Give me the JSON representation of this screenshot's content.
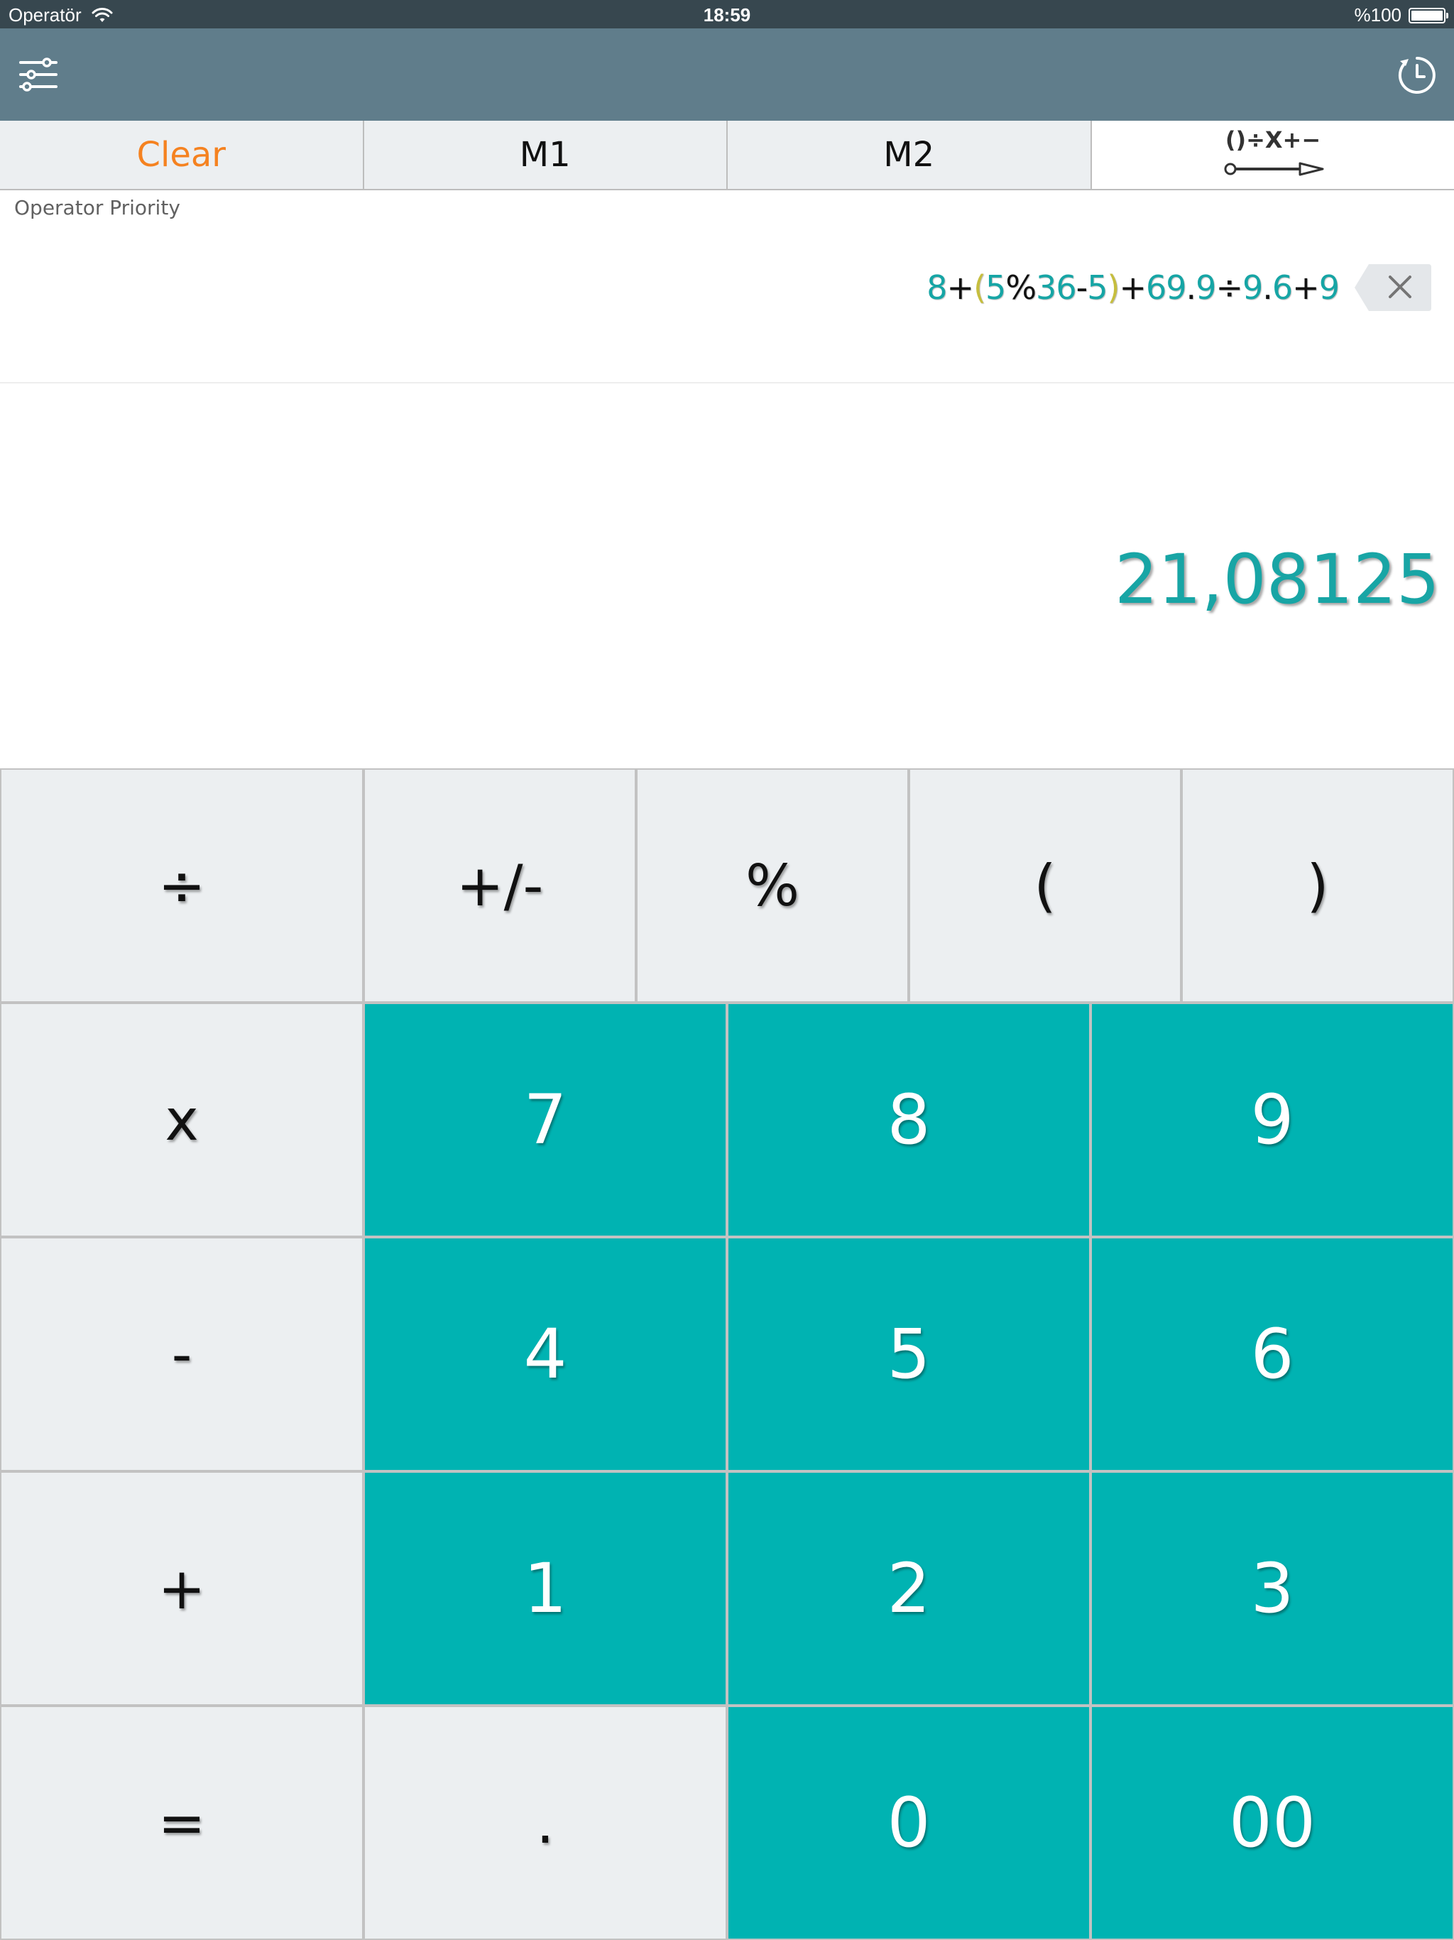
{
  "status_bar": {
    "carrier": "Operatör",
    "time": "18:59",
    "battery": "%100"
  },
  "toolbar": {
    "settings_icon": "sliders-icon",
    "history_icon": "history-clock-icon"
  },
  "memory_row": {
    "clear_label": "Clear",
    "m1_label": "M1",
    "m2_label": "M2",
    "mode_icon": "operator-order-icon",
    "mode_icon_text": "()÷X+−"
  },
  "display": {
    "mode_label": "Operator Priority",
    "expression_tokens": [
      {
        "t": "8",
        "k": "num"
      },
      {
        "t": "+",
        "k": "op"
      },
      {
        "t": "(",
        "k": "paren"
      },
      {
        "t": "5",
        "k": "num"
      },
      {
        "t": "%",
        "k": "op"
      },
      {
        "t": "36",
        "k": "num"
      },
      {
        "t": "-",
        "k": "op"
      },
      {
        "t": "5",
        "k": "num"
      },
      {
        "t": ")",
        "k": "paren"
      },
      {
        "t": "+",
        "k": "op"
      },
      {
        "t": "69",
        "k": "num"
      },
      {
        "t": ".",
        "k": "op"
      },
      {
        "t": "9",
        "k": "num"
      },
      {
        "t": "÷",
        "k": "op"
      },
      {
        "t": "9",
        "k": "num"
      },
      {
        "t": ".",
        "k": "op"
      },
      {
        "t": "6",
        "k": "num"
      },
      {
        "t": "+",
        "k": "op"
      },
      {
        "t": "9",
        "k": "num"
      }
    ],
    "result": "21,08125",
    "backspace_icon": "backspace-icon"
  },
  "keypad": {
    "row1": [
      {
        "label": "÷",
        "name": "divide-key"
      },
      {
        "label": "+/-",
        "name": "sign-toggle-key"
      },
      {
        "label": "%",
        "name": "percent-key"
      },
      {
        "label": "(",
        "name": "open-paren-key"
      },
      {
        "label": ")",
        "name": "close-paren-key"
      }
    ],
    "rows": [
      [
        {
          "label": "x",
          "name": "multiply-key",
          "kind": "func"
        },
        {
          "label": "7",
          "name": "digit-7-key",
          "kind": "digit"
        },
        {
          "label": "8",
          "name": "digit-8-key",
          "kind": "digit"
        },
        {
          "label": "9",
          "name": "digit-9-key",
          "kind": "digit"
        }
      ],
      [
        {
          "label": "-",
          "name": "minus-key",
          "kind": "func"
        },
        {
          "label": "4",
          "name": "digit-4-key",
          "kind": "digit"
        },
        {
          "label": "5",
          "name": "digit-5-key",
          "kind": "digit"
        },
        {
          "label": "6",
          "name": "digit-6-key",
          "kind": "digit"
        }
      ],
      [
        {
          "label": "+",
          "name": "plus-key",
          "kind": "func"
        },
        {
          "label": "1",
          "name": "digit-1-key",
          "kind": "digit"
        },
        {
          "label": "2",
          "name": "digit-2-key",
          "kind": "digit"
        },
        {
          "label": "3",
          "name": "digit-3-key",
          "kind": "digit"
        }
      ],
      [
        {
          "label": "=",
          "name": "equals-key",
          "kind": "func"
        },
        {
          "label": ".",
          "name": "decimal-key",
          "kind": "func"
        },
        {
          "label": "0",
          "name": "digit-0-key",
          "kind": "digit"
        },
        {
          "label": "00",
          "name": "double-zero-key",
          "kind": "digit"
        }
      ]
    ]
  },
  "colors": {
    "status_bar": "#37474f",
    "toolbar": "#607d8b",
    "clear_text": "#f58220",
    "digit_key": "#00b3b2",
    "func_key": "#eceff1",
    "result_text": "#18a5a5",
    "expression_number": "#16a5a5",
    "expression_paren": "#c6be3e"
  }
}
